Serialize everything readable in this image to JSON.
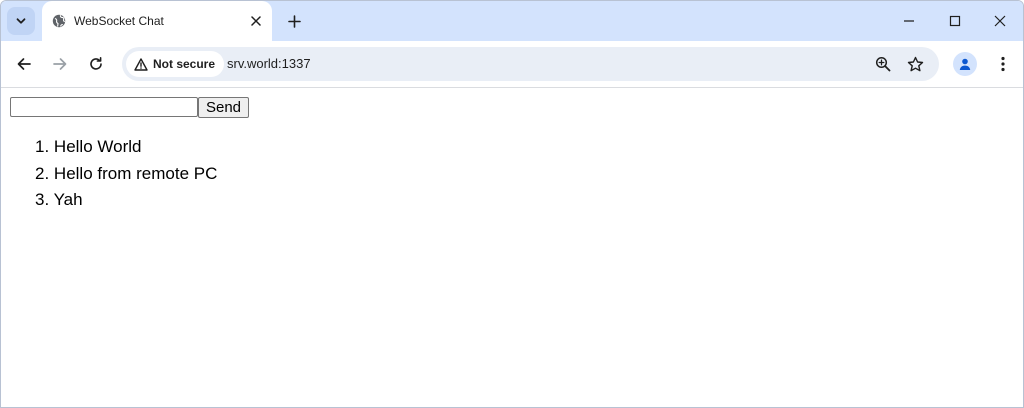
{
  "browser": {
    "tab": {
      "title": "WebSocket Chat"
    },
    "address": {
      "security_label": "Not secure",
      "url": "srv.world:1337"
    }
  },
  "chat": {
    "input_value": "",
    "send_label": "Send",
    "messages": [
      {
        "number": "1.",
        "text": "Hello World"
      },
      {
        "number": "2.",
        "text": "Hello from remote PC"
      },
      {
        "number": "3.",
        "text": "Yah"
      }
    ]
  }
}
